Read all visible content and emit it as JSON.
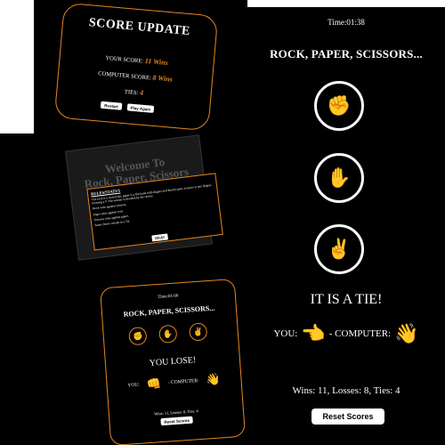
{
  "main": {
    "timer": "Time:01:38",
    "title": "ROCK, PAPER, SCISSORS...",
    "choices": {
      "rock": "✊",
      "paper": "✋",
      "scissors": "✌"
    },
    "result": "IT IS A TIE!",
    "you_label": "YOU:",
    "you_hand": "👈",
    "computer_label": "- COMPUTER:",
    "computer_hand": "👋",
    "score": "Wins: 11, Losses: 8, Ties: 4",
    "reset_label": "Reset Scores"
  },
  "score_update": {
    "title": "SCORE UPDATE",
    "your_label": "YOUR SCORE:",
    "your_value": "11 Wins",
    "computer_label": "COMPUTER SCORE:",
    "computer_value": "8 Wins",
    "ties_label": "TIES:",
    "ties_value": "4",
    "restart_label": "Restart",
    "play_again_label": "Play Again"
  },
  "welcome": {
    "title_line1": "Welcome To",
    "title_line2": "Rock, Paper, Scissors",
    "rules_heading": "RULES/STATUS",
    "rule1": "The rock is a closed fist; paper is a flat hand with fingers and thumb open; scissors is two fingers forming a V. The winner is decided by the choice.",
    "rule2": "Rock wins against scissors.",
    "rule3": "Paper wins against rock.",
    "rule4": "Scissors wins against paper.",
    "rule5": "Same choice results in a Tie.",
    "okay_label": "OKAY"
  },
  "small_game": {
    "timer": "Time:01:00",
    "title": "ROCK, PAPER, SCISSORS...",
    "choices": {
      "rock": "✊",
      "paper": "✋",
      "scissors": "✌"
    },
    "result": "YOU LOSE!",
    "you_label": "YOU:",
    "you_hand": "👊",
    "computer_label": "- COMPUTER:",
    "computer_hand": "👋",
    "score": "Wins: 11, Losses: 8, Ties: 4",
    "reset_label": "Reset Scores"
  },
  "colors": {
    "accent": "#e5861f",
    "background": "#000000",
    "text": "#ffffff"
  }
}
